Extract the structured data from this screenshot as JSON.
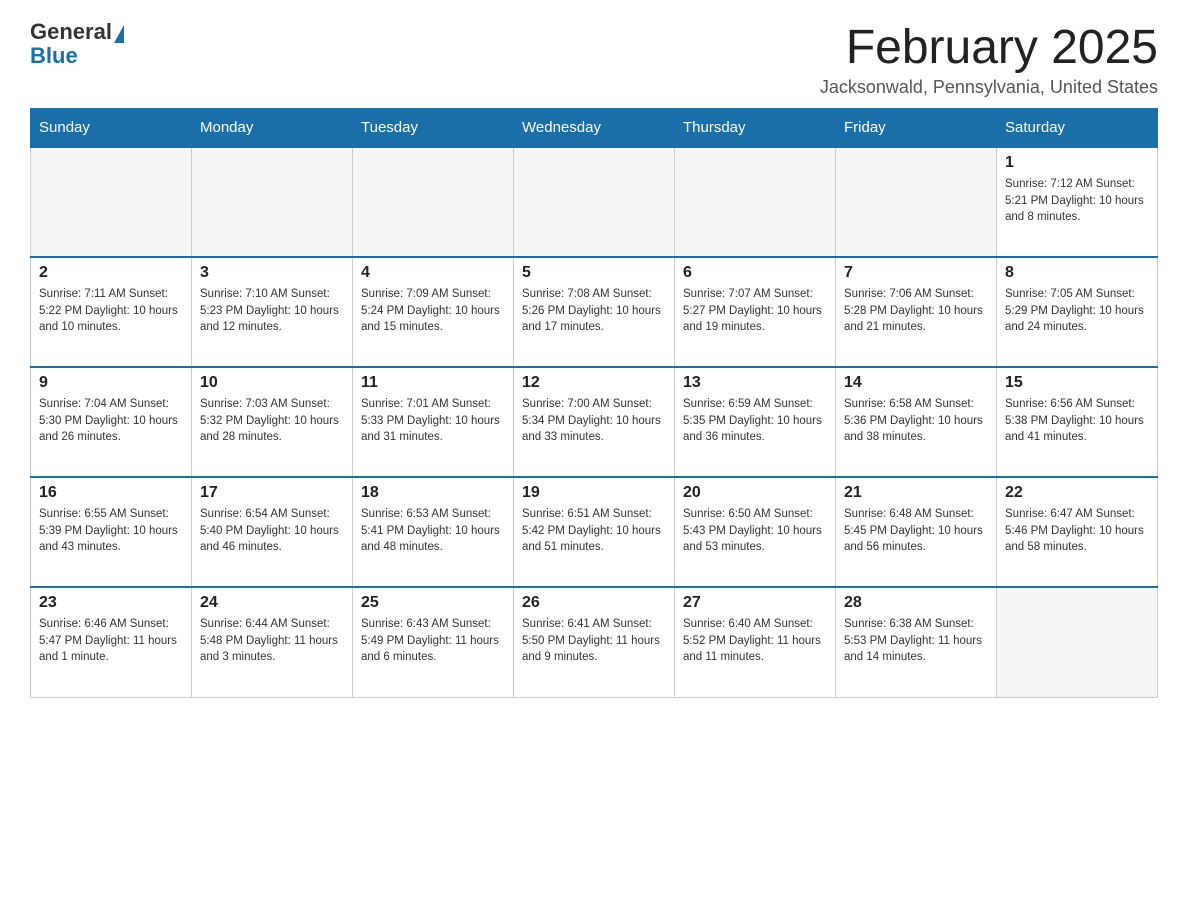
{
  "logo": {
    "general": "General",
    "triangle": "",
    "blue": "Blue"
  },
  "title": "February 2025",
  "subtitle": "Jacksonwald, Pennsylvania, United States",
  "days_of_week": [
    "Sunday",
    "Monday",
    "Tuesday",
    "Wednesday",
    "Thursday",
    "Friday",
    "Saturday"
  ],
  "weeks": [
    [
      {
        "day": "",
        "info": ""
      },
      {
        "day": "",
        "info": ""
      },
      {
        "day": "",
        "info": ""
      },
      {
        "day": "",
        "info": ""
      },
      {
        "day": "",
        "info": ""
      },
      {
        "day": "",
        "info": ""
      },
      {
        "day": "1",
        "info": "Sunrise: 7:12 AM\nSunset: 5:21 PM\nDaylight: 10 hours and 8 minutes."
      }
    ],
    [
      {
        "day": "2",
        "info": "Sunrise: 7:11 AM\nSunset: 5:22 PM\nDaylight: 10 hours and 10 minutes."
      },
      {
        "day": "3",
        "info": "Sunrise: 7:10 AM\nSunset: 5:23 PM\nDaylight: 10 hours and 12 minutes."
      },
      {
        "day": "4",
        "info": "Sunrise: 7:09 AM\nSunset: 5:24 PM\nDaylight: 10 hours and 15 minutes."
      },
      {
        "day": "5",
        "info": "Sunrise: 7:08 AM\nSunset: 5:26 PM\nDaylight: 10 hours and 17 minutes."
      },
      {
        "day": "6",
        "info": "Sunrise: 7:07 AM\nSunset: 5:27 PM\nDaylight: 10 hours and 19 minutes."
      },
      {
        "day": "7",
        "info": "Sunrise: 7:06 AM\nSunset: 5:28 PM\nDaylight: 10 hours and 21 minutes."
      },
      {
        "day": "8",
        "info": "Sunrise: 7:05 AM\nSunset: 5:29 PM\nDaylight: 10 hours and 24 minutes."
      }
    ],
    [
      {
        "day": "9",
        "info": "Sunrise: 7:04 AM\nSunset: 5:30 PM\nDaylight: 10 hours and 26 minutes."
      },
      {
        "day": "10",
        "info": "Sunrise: 7:03 AM\nSunset: 5:32 PM\nDaylight: 10 hours and 28 minutes."
      },
      {
        "day": "11",
        "info": "Sunrise: 7:01 AM\nSunset: 5:33 PM\nDaylight: 10 hours and 31 minutes."
      },
      {
        "day": "12",
        "info": "Sunrise: 7:00 AM\nSunset: 5:34 PM\nDaylight: 10 hours and 33 minutes."
      },
      {
        "day": "13",
        "info": "Sunrise: 6:59 AM\nSunset: 5:35 PM\nDaylight: 10 hours and 36 minutes."
      },
      {
        "day": "14",
        "info": "Sunrise: 6:58 AM\nSunset: 5:36 PM\nDaylight: 10 hours and 38 minutes."
      },
      {
        "day": "15",
        "info": "Sunrise: 6:56 AM\nSunset: 5:38 PM\nDaylight: 10 hours and 41 minutes."
      }
    ],
    [
      {
        "day": "16",
        "info": "Sunrise: 6:55 AM\nSunset: 5:39 PM\nDaylight: 10 hours and 43 minutes."
      },
      {
        "day": "17",
        "info": "Sunrise: 6:54 AM\nSunset: 5:40 PM\nDaylight: 10 hours and 46 minutes."
      },
      {
        "day": "18",
        "info": "Sunrise: 6:53 AM\nSunset: 5:41 PM\nDaylight: 10 hours and 48 minutes."
      },
      {
        "day": "19",
        "info": "Sunrise: 6:51 AM\nSunset: 5:42 PM\nDaylight: 10 hours and 51 minutes."
      },
      {
        "day": "20",
        "info": "Sunrise: 6:50 AM\nSunset: 5:43 PM\nDaylight: 10 hours and 53 minutes."
      },
      {
        "day": "21",
        "info": "Sunrise: 6:48 AM\nSunset: 5:45 PM\nDaylight: 10 hours and 56 minutes."
      },
      {
        "day": "22",
        "info": "Sunrise: 6:47 AM\nSunset: 5:46 PM\nDaylight: 10 hours and 58 minutes."
      }
    ],
    [
      {
        "day": "23",
        "info": "Sunrise: 6:46 AM\nSunset: 5:47 PM\nDaylight: 11 hours and 1 minute."
      },
      {
        "day": "24",
        "info": "Sunrise: 6:44 AM\nSunset: 5:48 PM\nDaylight: 11 hours and 3 minutes."
      },
      {
        "day": "25",
        "info": "Sunrise: 6:43 AM\nSunset: 5:49 PM\nDaylight: 11 hours and 6 minutes."
      },
      {
        "day": "26",
        "info": "Sunrise: 6:41 AM\nSunset: 5:50 PM\nDaylight: 11 hours and 9 minutes."
      },
      {
        "day": "27",
        "info": "Sunrise: 6:40 AM\nSunset: 5:52 PM\nDaylight: 11 hours and 11 minutes."
      },
      {
        "day": "28",
        "info": "Sunrise: 6:38 AM\nSunset: 5:53 PM\nDaylight: 11 hours and 14 minutes."
      },
      {
        "day": "",
        "info": ""
      }
    ]
  ]
}
